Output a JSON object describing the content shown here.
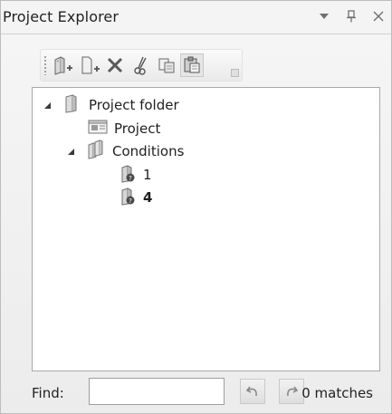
{
  "window": {
    "title": "Project Explorer",
    "controls": [
      "dropdown-arrow-icon",
      "pin-icon",
      "close-icon"
    ]
  },
  "toolbar": {
    "buttons": [
      {
        "icon": "add-folder-icon"
      },
      {
        "icon": "add-item-icon"
      },
      {
        "icon": "delete-icon"
      },
      {
        "icon": "cut-icon"
      },
      {
        "icon": "copy-icon"
      },
      {
        "icon": "paste-icon",
        "active": true
      }
    ]
  },
  "tree": {
    "items": [
      {
        "label": "Project folder",
        "icon": "folder-icon",
        "expanded": true
      },
      {
        "label": "Project",
        "icon": "project-icon"
      },
      {
        "label": "Conditions",
        "icon": "conditions-icon",
        "expanded": true
      },
      {
        "label": "1",
        "icon": "condition-icon"
      },
      {
        "label": "4",
        "icon": "condition-icon",
        "selected": true
      }
    ]
  },
  "find": {
    "label": "Find:",
    "value": "",
    "placeholder": "",
    "undo_icon": "undo-icon",
    "redo_icon": "redo-icon",
    "matches": "0 matches"
  }
}
